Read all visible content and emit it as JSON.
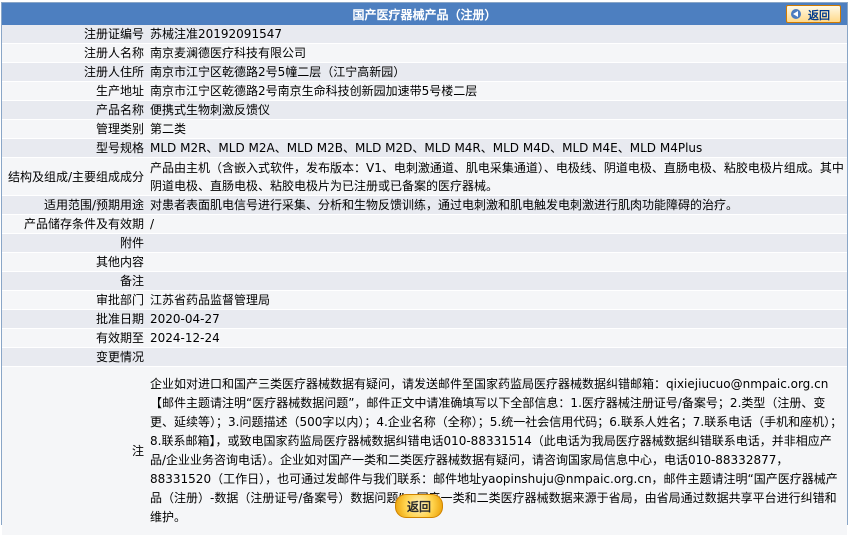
{
  "header": {
    "title": "国产医疗器械产品（注册）",
    "back_label": "返回"
  },
  "rows": [
    {
      "key": "注册证编号",
      "value": "苏械注准20192091547"
    },
    {
      "key": "注册人名称",
      "value": "南京麦澜德医疗科技有限公司"
    },
    {
      "key": "注册人住所",
      "value": "南京市江宁区乾德路2号5幢二层（江宁高新园）"
    },
    {
      "key": "生产地址",
      "value": "南京市江宁区乾德路2号南京生命科技创新园加速带5号楼二层"
    },
    {
      "key": "产品名称",
      "value": "便携式生物刺激反馈仪"
    },
    {
      "key": "管理类别",
      "value": "第二类"
    },
    {
      "key": "型号规格",
      "value": "MLD M2R、MLD M2A、MLD M2B、MLD M2D、MLD M4R、MLD M4D、MLD M4E、MLD M4Plus"
    },
    {
      "key": "结构及组成/主要组成成分",
      "value": "产品由主机（含嵌入式软件，发布版本：V1、电刺激通道、肌电采集通道）、电极线、阴道电极、直肠电极、粘胶电极片组成。其中阴道电极、直肠电极、粘胶电极片为已注册或已备案的医疗器械。"
    },
    {
      "key": "适用范围/预期用途",
      "value": "对患者表面肌电信号进行采集、分析和生物反馈训练，通过电刺激和肌电触发电刺激进行肌肉功能障碍的治疗。"
    },
    {
      "key": "产品储存条件及有效期",
      "value": "/"
    },
    {
      "key": "附件",
      "value": ""
    },
    {
      "key": "其他内容",
      "value": ""
    },
    {
      "key": "备注",
      "value": ""
    },
    {
      "key": "审批部门",
      "value": "江苏省药品监督管理局"
    },
    {
      "key": "批准日期",
      "value": "2020-04-27"
    },
    {
      "key": "有效期至",
      "value": "2024-12-24"
    },
    {
      "key": "变更情况",
      "value": ""
    }
  ],
  "note": {
    "key": "注",
    "value": "企业如对进口和国产三类医疗器械数据有疑问，请发送邮件至国家药监局医疗器械数据纠错邮箱：qixiejiucuo@nmpaic.org.cn【邮件主题请注明“医疗器械数据问题”，邮件正文中请准确填写以下全部信息：1.医疗器械注册证号/备案号；2.类型（注册、变更、延续等）；3.问题描述（500字以内）；4.企业名称（全称）；5.统一社会信用代码；6.联系人姓名；7.联系电话（手机和座机）；8.联系邮箱】，或致电国家药监局医疗器械数据纠错电话010-88331514（此电话为我局医疗器械数据纠错联系电话，并非相应产品/企业业务咨询电话）。企业如对国产一类和二类医疗器械数据有疑问，请咨询国家局信息中心，电话010-88332877，88331520（工作日），也可通过发邮件与我们联系：邮件地址yaopinshuju@nmpaic.org.cn，邮件主题请注明“国产医疗器械产品（注册）-数据（注册证号/备案号）数据问题”。国产一类和二类医疗器械数据来源于省局，由省局通过数据共享平台进行纠错和维护。"
  },
  "footer": {
    "back_label": "返回"
  }
}
